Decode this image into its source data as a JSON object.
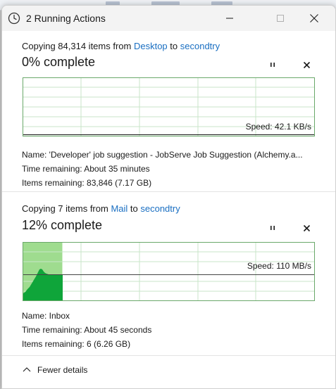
{
  "window": {
    "title": "2 Running Actions"
  },
  "operations": [
    {
      "prefix": "Copying 84,314 items from ",
      "source": "Desktop",
      "joiner": " to ",
      "destination": "secondtry",
      "percent_label": "0% complete",
      "percent": 0,
      "speed_label": "Speed: 42.1 KB/s",
      "name_label": "Name: 'Developer' job suggestion - JobServe Job Suggestion (Alchemy.a...",
      "time_remaining": "Time remaining: About 35 minutes",
      "items_remaining": "Items remaining: 83,846 (7.17 GB)"
    },
    {
      "prefix": "Copying 7 items from ",
      "source": "Mail",
      "joiner": " to ",
      "destination": "secondtry",
      "percent_label": "12% complete",
      "percent": 12,
      "speed_label": "Speed: 110 MB/s",
      "name_label": "Name: Inbox",
      "time_remaining": "Time remaining: About 45 seconds",
      "items_remaining": "Items remaining: 6 (6.26 GB)"
    }
  ],
  "footer": {
    "toggle_label": "Fewer details"
  },
  "icons": {
    "app": "clock-icon",
    "pause": "pause-icon",
    "cancel": "close-icon",
    "minimize": "minimize-icon",
    "maximize": "maximize-icon",
    "close": "close-icon",
    "collapse": "chevron-up-icon"
  },
  "colors": {
    "link": "#1a6fc2",
    "graph_border": "#6aa86a",
    "graph_grid": "#c9e6c9",
    "progress_fill": "#9fdc8f",
    "speed_area": "#0fa53a"
  }
}
